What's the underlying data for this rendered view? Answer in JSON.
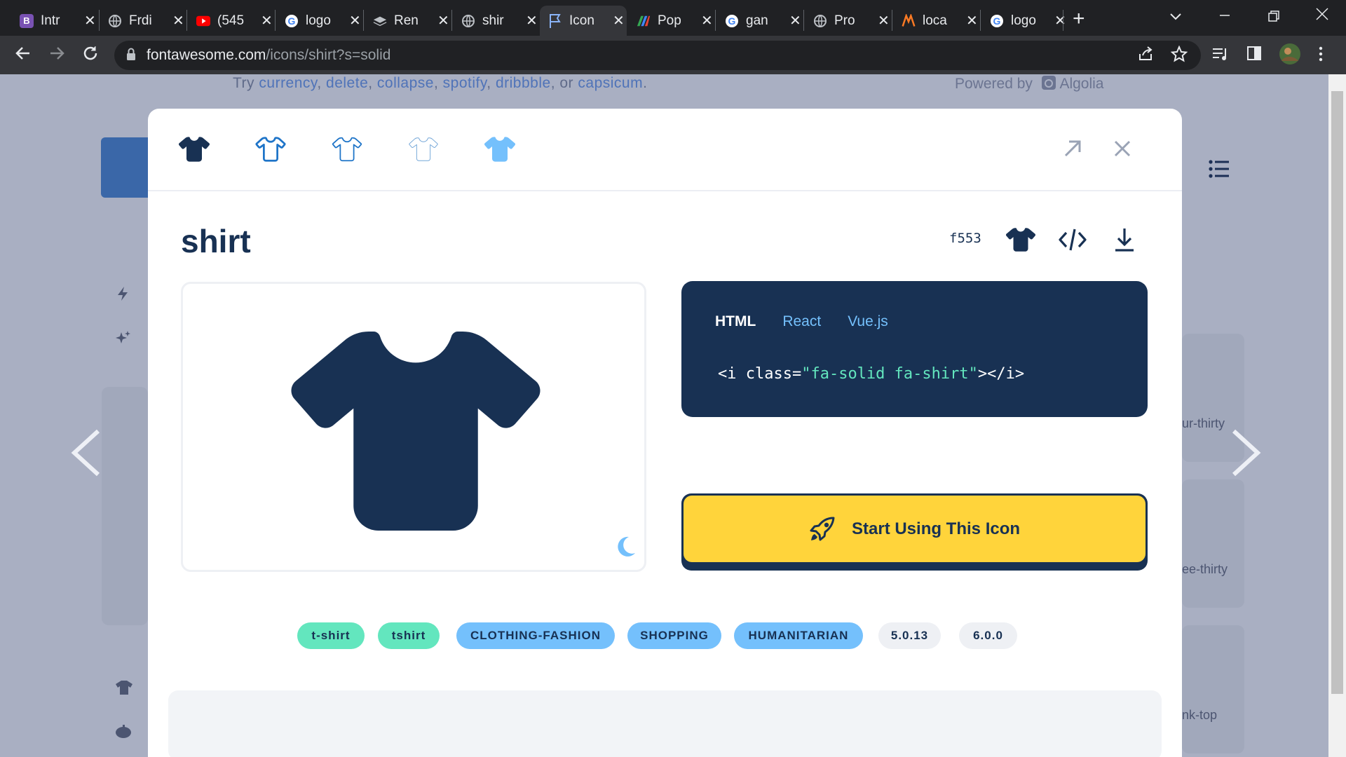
{
  "browser": {
    "tabs": [
      {
        "title": "Intr",
        "favicon": "bootstrap-icon",
        "favicon_color": "#7952b3",
        "active": false
      },
      {
        "title": "Frdi",
        "favicon": "globe-icon",
        "active": false
      },
      {
        "title": "(545",
        "favicon": "youtube-icon",
        "favicon_color": "#ff0000",
        "active": false
      },
      {
        "title": "logo",
        "favicon": "google-icon",
        "active": false
      },
      {
        "title": "Ren",
        "favicon": "layers-icon",
        "active": false
      },
      {
        "title": "shir",
        "favicon": "globe-icon",
        "active": false
      },
      {
        "title": "Icon",
        "favicon": "flag-icon",
        "active": true
      },
      {
        "title": "Pop",
        "favicon": "colorful-icon",
        "active": false
      },
      {
        "title": "gan",
        "favicon": "google-icon",
        "active": false
      },
      {
        "title": "Pro",
        "favicon": "globe-icon",
        "active": false
      },
      {
        "title": "loca",
        "favicon": "xampp-icon",
        "favicon_color": "#fb7a24",
        "active": false
      },
      {
        "title": "logo",
        "favicon": "google-icon",
        "active": false
      }
    ],
    "tab_close": "✕",
    "new_tab": "+",
    "url_host": "fontawesome.com",
    "url_path": "/icons/shirt?s=solid"
  },
  "page": {
    "suggest_prefix": "Try",
    "suggestions": [
      "currency",
      "delete",
      "collapse",
      "spotify",
      "dribbble",
      "capsicum"
    ],
    "suggest_or": ", or",
    "powered_by": "Powered by",
    "algolia": "Algolia",
    "bg_labels": [
      "ur-thirty",
      "ee-thirty",
      "nk-top"
    ]
  },
  "modal": {
    "style_variants": [
      "solid",
      "regular",
      "light",
      "thin",
      "duotone"
    ],
    "icon_name": "shirt",
    "unicode": "f553",
    "code_tabs": [
      "HTML",
      "React",
      "Vue.js"
    ],
    "code_open": "<i class=",
    "code_class": "\"fa-solid fa-shirt\"",
    "code_close": "></i>",
    "cta_label": "Start Using This Icon",
    "tags": [
      {
        "label": "t-shirt",
        "kind": "alias"
      },
      {
        "label": "tshirt",
        "kind": "alias"
      },
      {
        "label": "CLOTHING-FASHION",
        "kind": "category"
      },
      {
        "label": "SHOPPING",
        "kind": "category"
      },
      {
        "label": "HUMANITARIAN",
        "kind": "category"
      },
      {
        "label": "5.0.13",
        "kind": "version"
      },
      {
        "label": "6.0.0",
        "kind": "version"
      }
    ]
  },
  "colors": {
    "navy": "#183153",
    "yellow": "#ffd43b",
    "teal": "#63e6be",
    "light_blue": "#74c0fc"
  }
}
